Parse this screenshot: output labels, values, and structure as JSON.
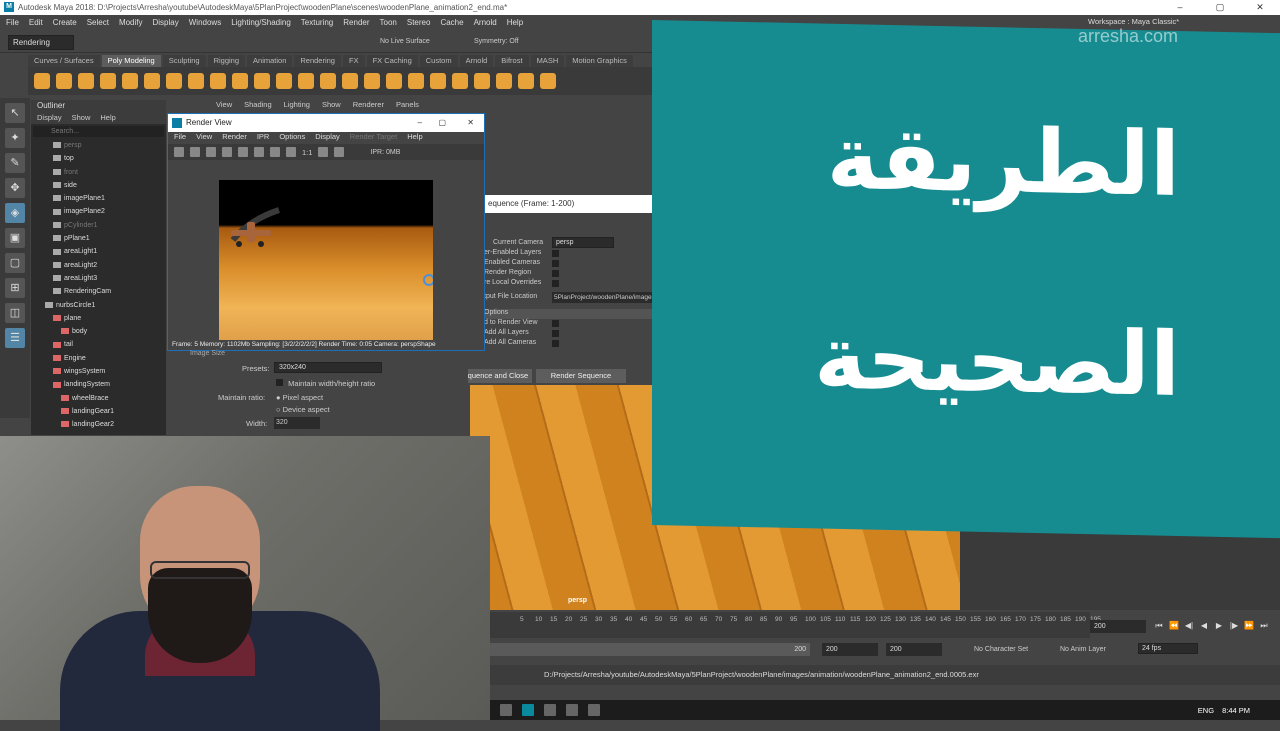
{
  "title_bar": {
    "app_title": "Autodesk Maya 2018: D:\\Projects\\Arresha\\youtube\\AutodeskMaya\\5PlanProject\\woodenPlane\\scenes\\woodenPlane_animation2_end.ma*",
    "logo": "M"
  },
  "menus": [
    "File",
    "Edit",
    "Create",
    "Select",
    "Modify",
    "Display",
    "Windows",
    "Lighting/Shading",
    "Texturing",
    "Render",
    "Toon",
    "Stereo",
    "Cache",
    "Arnold",
    "Help"
  ],
  "workspace": {
    "label": "Workspace :",
    "value": "Maya Classic*"
  },
  "status_line": {
    "menu_set": "Rendering",
    "live_surface": "No Live Surface",
    "symmetry": "Symmetry: Off"
  },
  "shelf_tabs": [
    "Curves / Surfaces",
    "Poly Modeling",
    "Sculpting",
    "Rigging",
    "Animation",
    "Rendering",
    "FX",
    "FX Caching",
    "Custom",
    "Arnold",
    "Bifrost",
    "MASH",
    "Motion Graphics"
  ],
  "shelf_active": "Poly Modeling",
  "outliner": {
    "title": "Outliner",
    "menu": [
      "Display",
      "Show",
      "Help"
    ],
    "search_placeholder": "Search...",
    "items": [
      {
        "label": "persp",
        "dim": true
      },
      {
        "label": "top",
        "dim": false
      },
      {
        "label": "front",
        "dim": true
      },
      {
        "label": "side",
        "dim": false
      },
      {
        "label": "imagePlane1",
        "dim": false
      },
      {
        "label": "imagePlane2",
        "dim": false
      },
      {
        "label": "pCylinder1",
        "dim": true
      },
      {
        "label": "pPlane1",
        "dim": false
      },
      {
        "label": "areaLight1",
        "dim": false
      },
      {
        "label": "areaLight2",
        "dim": false
      },
      {
        "label": "areaLight3",
        "dim": false
      },
      {
        "label": "RenderingCam",
        "dim": false
      },
      {
        "label": "nurbsCircle1",
        "dim": false
      },
      {
        "label": "plane",
        "dim": false
      },
      {
        "label": "body",
        "dim": false
      },
      {
        "label": "tail",
        "dim": false
      },
      {
        "label": "Engine",
        "dim": false
      },
      {
        "label": "wingsSystem",
        "dim": false
      },
      {
        "label": "landingSystem",
        "dim": false
      },
      {
        "label": "wheelBrace",
        "dim": false
      },
      {
        "label": "landingGear1",
        "dim": false
      },
      {
        "label": "landingGear2",
        "dim": false
      }
    ]
  },
  "viewport_menu": [
    "View",
    "Shading",
    "Lighting",
    "Show",
    "Renderer",
    "Panels"
  ],
  "viewport_label": "persp",
  "render_view": {
    "title": "Render View",
    "menu": [
      "File",
      "View",
      "Render",
      "IPR",
      "Options",
      "Display",
      "Render Target",
      "Help"
    ],
    "ipr_label": "IPR: 0MB",
    "zoom": "1:1",
    "status": "Frame: 5    Memory: 1102Mb    Sampling: [3/2/2/2/2/2]    Render Time: 0:05    Camera: perspShape"
  },
  "render_sequence": {
    "title": "equence (Frame: 1-200)",
    "current_camera_label": "Current Camera",
    "current_camera": "persp",
    "rows": [
      "er-Enabled Layers",
      "Enabled Cameras",
      "Render Region",
      "re Local Overrides"
    ],
    "output_label": "tput File Location",
    "output_value": "5PlanProject/woodenPlane/images/animation",
    "options_header": "Options",
    "option_rows": [
      "d to Render View",
      "Add All Layers",
      "Add All Cameras"
    ],
    "btn_close": "Render Sequence and Close",
    "btn_render": "Render Sequence"
  },
  "attributes": {
    "image_size": "Image Size",
    "presets_label": "Presets:",
    "presets_value": "320x240",
    "maintain_wh": "Maintain width/height ratio",
    "maintain_ratio_label": "Maintain ratio:",
    "pixel_aspect": "Pixel aspect",
    "device_aspect": "Device aspect",
    "width_label": "Width:",
    "width_value": "320"
  },
  "layers": {
    "layer_name": "imagePlanes",
    "flags": [
      "V",
      "P",
      "R"
    ]
  },
  "timeline": {
    "ticks": [
      5,
      10,
      15,
      20,
      25,
      30,
      35,
      40,
      45,
      50,
      55,
      60,
      65,
      70,
      75,
      80,
      85,
      90,
      95,
      100,
      105,
      110,
      115,
      120,
      125,
      130,
      135,
      140,
      145,
      150,
      155,
      160,
      165,
      170,
      175,
      180,
      185,
      190,
      195
    ],
    "current_frame": "200"
  },
  "range": {
    "start": "200",
    "end": "200",
    "max": "200",
    "char_set": "No Character Set",
    "anim_layer": "No Anim Layer",
    "fps": "24 fps"
  },
  "command_line": "D:/Projects/Arresha/youtube/AutodeskMaya/5PlanProject/woodenPlane/images/animation/woodenPlane_animation2_end.0005.exr",
  "taskbar": {
    "lang": "ENG",
    "time": "8:44 PM"
  },
  "overlay": {
    "line1": "الطريقة",
    "line2": "الصحيحة",
    "watermark": "arresha.com",
    "color": "#168c91"
  }
}
